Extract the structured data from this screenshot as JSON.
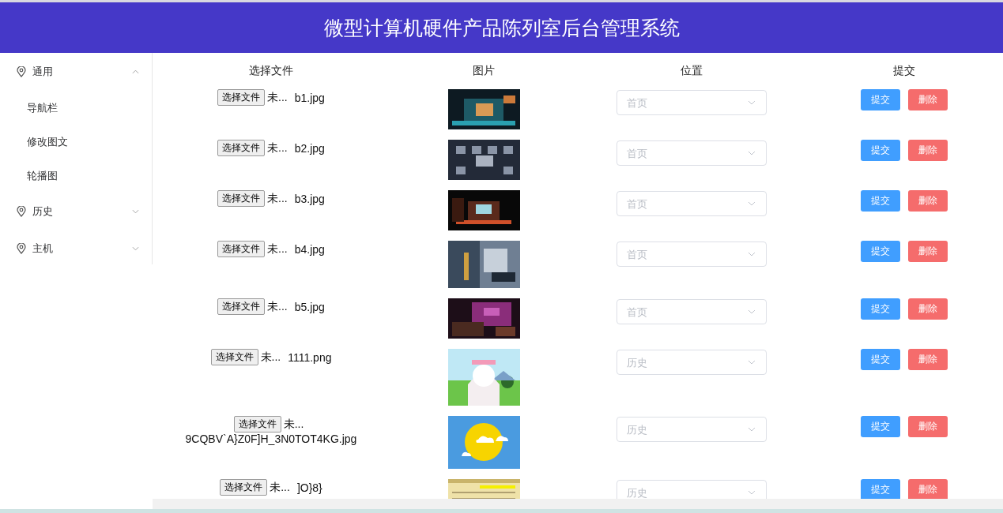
{
  "header": {
    "title": "微型计算机硬件产品陈列室后台管理系统"
  },
  "sidebar": {
    "groups": [
      {
        "label": "通用",
        "expanded": true,
        "children": [
          {
            "label": "导航栏"
          },
          {
            "label": "修改图文"
          },
          {
            "label": "轮播图"
          }
        ]
      },
      {
        "label": "历史",
        "expanded": false
      },
      {
        "label": "主机",
        "expanded": false
      }
    ]
  },
  "table": {
    "columns": [
      "选择文件",
      "图片",
      "位置",
      "提交"
    ],
    "rows": [
      {
        "file_button": "选择文件",
        "file_status": "未...",
        "filename": "b1.jpg",
        "position": {
          "placeholder": "首页"
        },
        "submit": "提交",
        "delete": "删除"
      },
      {
        "file_button": "选择文件",
        "file_status": "未...",
        "filename": "b2.jpg",
        "position": {
          "placeholder": "首页"
        },
        "submit": "提交",
        "delete": "删除"
      },
      {
        "file_button": "选择文件",
        "file_status": "未...",
        "filename": "b3.jpg",
        "position": {
          "placeholder": "首页"
        },
        "submit": "提交",
        "delete": "删除"
      },
      {
        "file_button": "选择文件",
        "file_status": "未...",
        "filename": "b4.jpg",
        "position": {
          "placeholder": "首页"
        },
        "submit": "提交",
        "delete": "删除"
      },
      {
        "file_button": "选择文件",
        "file_status": "未...",
        "filename": "b5.jpg",
        "position": {
          "placeholder": "首页"
        },
        "submit": "提交",
        "delete": "删除"
      },
      {
        "file_button": "选择文件",
        "file_status": "未...",
        "filename": "1111.png",
        "position": {
          "placeholder": "历史"
        },
        "submit": "提交",
        "delete": "删除"
      },
      {
        "file_button": "选择文件",
        "file_status": "未...",
        "filename": "9CQBV`A}Z0F]H_3N0TOT4KG.jpg",
        "position": {
          "placeholder": "历史"
        },
        "submit": "提交",
        "delete": "删除"
      },
      {
        "file_button": "选择文件",
        "file_status": "未...",
        "filename": "]O}8}",
        "position": {
          "placeholder": "历史"
        },
        "submit": "提交",
        "delete": "删除"
      }
    ]
  }
}
